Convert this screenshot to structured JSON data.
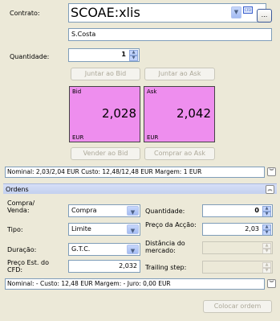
{
  "contract": {
    "label": "Contrato:",
    "value": "SCOAE:xlis",
    "cfd_icon_label": "CFD",
    "ellipsis_label": "...",
    "account": "S.Costa"
  },
  "quantity": {
    "label": "Quantidade:",
    "value": "1"
  },
  "buttons": {
    "join_bid": "Juntar ao Bid",
    "join_ask": "Juntar ao Ask",
    "sell_bid": "Vender ao Bid",
    "buy_ask": "Comprar ao Ask"
  },
  "bid": {
    "label": "Bid",
    "value": "2,028",
    "currency": "EUR",
    "color": "#ee8eee"
  },
  "ask": {
    "label": "Ask",
    "value": "2,042",
    "currency": "EUR",
    "color": "#ee8eee"
  },
  "summary1": "Nominal: 2,03/2,04 EUR   Custo: 12,48/12,48 EUR   Margem: 1 EUR",
  "orders": {
    "title": "Ordens",
    "buy_sell_label": "Compra/ Venda:",
    "buy_sell_value": "Compra",
    "type_label": "Tipo:",
    "type_value": "Limite",
    "duration_label": "Duração:",
    "duration_value": "G.T.C.",
    "cfd_price_label": "Preço Est. do CFD:",
    "cfd_price_value": "2,032",
    "qty_label": "Quantidade:",
    "qty_value": "0",
    "price_label": "Preço da Acção:",
    "price_value": "2,03",
    "distance_label": "Distância do mercado:",
    "distance_value": "",
    "trailing_label": "Trailing step:",
    "trailing_value": "",
    "summary": "Nominal: -   Custo: 12,48 EUR   Margem: -   Juro: 0,00 EUR",
    "place_button": "Colocar ordem"
  }
}
